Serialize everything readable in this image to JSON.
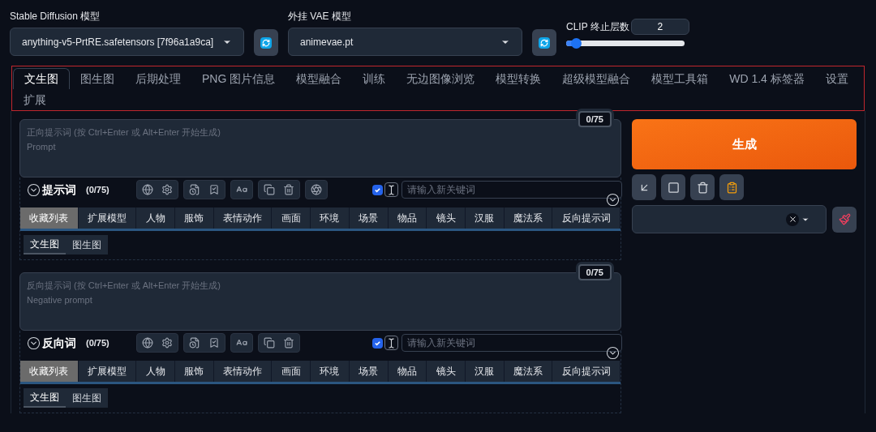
{
  "sd_model": {
    "label": "Stable Diffusion 模型",
    "value": "anything-v5-PrtRE.safetensors [7f96a1a9ca]"
  },
  "vae_model": {
    "label": "外挂 VAE 模型",
    "value": "animevae.pt"
  },
  "clip_skip": {
    "label": "CLIP 终止层数",
    "value": "2",
    "level": 0.08
  },
  "tabs": [
    {
      "label": "文生图",
      "selected": true
    },
    {
      "label": "图生图",
      "selected": false
    },
    {
      "label": "后期处理",
      "selected": false
    },
    {
      "label": "PNG 图片信息",
      "selected": false
    },
    {
      "label": "模型融合",
      "selected": false
    },
    {
      "label": "训练",
      "selected": false
    },
    {
      "label": "无边图像浏览",
      "selected": false
    },
    {
      "label": "模型转换",
      "selected": false
    },
    {
      "label": "超级模型融合",
      "selected": false
    },
    {
      "label": "模型工具箱",
      "selected": false
    },
    {
      "label": "WD 1.4 标签器",
      "selected": false
    },
    {
      "label": "设置",
      "selected": false
    },
    {
      "label": "扩展",
      "selected": false
    }
  ],
  "prompts": [
    {
      "counter": "0/75",
      "placeholder": [
        "正向提示词 (按 Ctrl+Enter 或 Alt+Enter 开始生成)",
        "Prompt"
      ],
      "title": "提示词",
      "count": "(0/75)",
      "extra_tool": true,
      "keyword_enabled": true,
      "keyword_placeholder": "请输入新关键词",
      "categories": [
        {
          "label": "收藏列表",
          "selected": true
        },
        {
          "label": "扩展模型",
          "selected": false
        },
        {
          "label": "人物",
          "selected": false
        },
        {
          "label": "服饰",
          "selected": false
        },
        {
          "label": "表情动作",
          "selected": false
        },
        {
          "label": "画面",
          "selected": false
        },
        {
          "label": "环境",
          "selected": false
        },
        {
          "label": "场景",
          "selected": false
        },
        {
          "label": "物品",
          "selected": false
        },
        {
          "label": "镜头",
          "selected": false
        },
        {
          "label": "汉服",
          "selected": false
        },
        {
          "label": "魔法系",
          "selected": false
        },
        {
          "label": "反向提示词",
          "selected": false
        }
      ],
      "subtabs": [
        {
          "label": "文生图",
          "selected": true
        },
        {
          "label": "图生图",
          "selected": false
        }
      ]
    },
    {
      "counter": "0/75",
      "placeholder": [
        "反向提示词 (按 Ctrl+Enter 或 Alt+Enter 开始生成)",
        "Negative prompt"
      ],
      "title": "反向词",
      "count": "(0/75)",
      "extra_tool": false,
      "keyword_enabled": true,
      "keyword_placeholder": "请输入新关键词",
      "categories": [
        {
          "label": "收藏列表",
          "selected": true
        },
        {
          "label": "扩展模型",
          "selected": false
        },
        {
          "label": "人物",
          "selected": false
        },
        {
          "label": "服饰",
          "selected": false
        },
        {
          "label": "表情动作",
          "selected": false
        },
        {
          "label": "画面",
          "selected": false
        },
        {
          "label": "环境",
          "selected": false
        },
        {
          "label": "场景",
          "selected": false
        },
        {
          "label": "物品",
          "selected": false
        },
        {
          "label": "镜头",
          "selected": false
        },
        {
          "label": "汉服",
          "selected": false
        },
        {
          "label": "魔法系",
          "selected": false
        },
        {
          "label": "反向提示词",
          "selected": false
        }
      ],
      "subtabs": [
        {
          "label": "文生图",
          "selected": true
        },
        {
          "label": "图生图",
          "selected": false
        }
      ]
    }
  ],
  "generate_button": "生成"
}
